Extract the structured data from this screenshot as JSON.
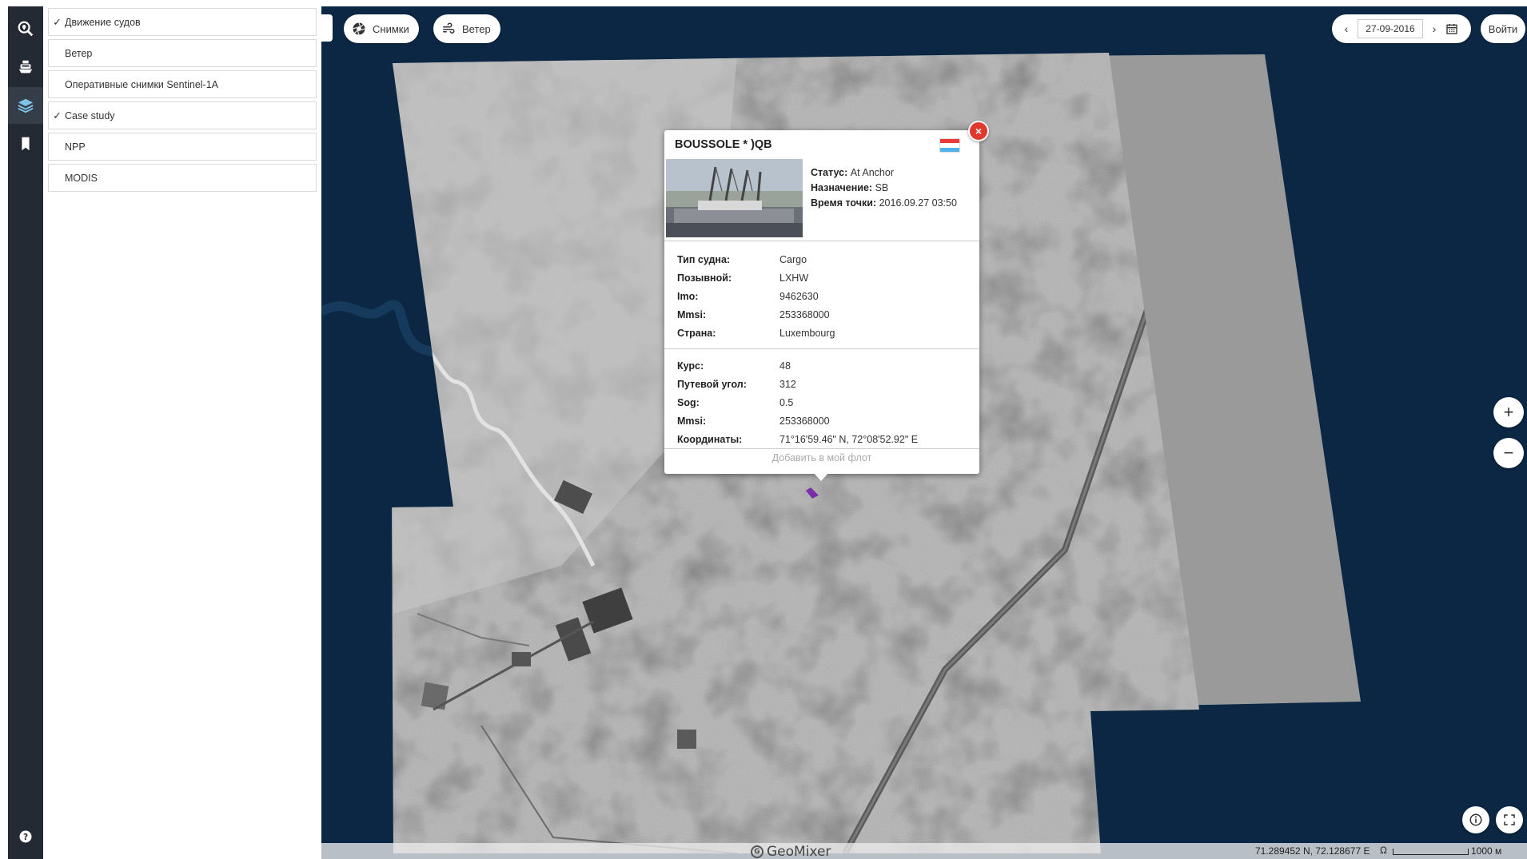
{
  "rail": {
    "items": [
      {
        "icon": "search-location-icon"
      },
      {
        "icon": "ship-icon"
      },
      {
        "icon": "layers-icon",
        "active": true
      },
      {
        "icon": "bookmark-icon"
      }
    ],
    "help_icon": "help-icon"
  },
  "layers": {
    "items": [
      {
        "label": "Движение судов",
        "check": "✓"
      },
      {
        "label": "Ветер",
        "check": ""
      },
      {
        "label": "Оперативные снимки Sentinel-1A",
        "check": ""
      },
      {
        "label": "Case study",
        "check": "✓"
      },
      {
        "label": "NPP",
        "check": ""
      },
      {
        "label": "MODIS",
        "check": ""
      }
    ]
  },
  "toolbar": {
    "snapshots_label": "Снимки",
    "wind_label": "Ветер",
    "date": "27-09-2016",
    "prev_arrow": "‹",
    "next_arrow": "›",
    "login_label": "Войти"
  },
  "zoom": {
    "in_label": "+",
    "out_label": "−"
  },
  "popup": {
    "title": "BOUSSOLE * )QB",
    "close_label": "×",
    "flag_colors": [
      "#ea3a3a",
      "#ffffff",
      "#4fb3e8"
    ],
    "summary": [
      {
        "key": "Статус:",
        "value": "At Anchor"
      },
      {
        "key": "Назначение:",
        "value": "SB"
      },
      {
        "key": "Время точки:",
        "value": "2016.09.27 03:50"
      }
    ],
    "props1": [
      {
        "key": "Тип судна:",
        "value": "Cargo"
      },
      {
        "key": "Позывной:",
        "value": "LXHW"
      },
      {
        "key": "Imo:",
        "value": "9462630"
      },
      {
        "key": "Mmsi:",
        "value": "253368000"
      },
      {
        "key": "Страна:",
        "value": "Luxembourg"
      }
    ],
    "props2": [
      {
        "key": "Курс:",
        "value": "48"
      },
      {
        "key": "Путевой угол:",
        "value": "312"
      },
      {
        "key": "Sog:",
        "value": "0.5"
      },
      {
        "key": "Mmsi:",
        "value": "253368000"
      },
      {
        "key": "Координаты:",
        "value": "71°16'59.46\" N, 72°08'52.92\" E"
      }
    ],
    "add_fleet_label": "Добавить в мой флот"
  },
  "statusbar": {
    "logo_text": "GeoMixer",
    "coords": "71.289452 N, 72.128677 E",
    "scale_label": "1000 м"
  },
  "colors": {
    "sea": "#0b2744",
    "rail": "#232a33",
    "close": "#e0382e",
    "marker": "#7a2fa8"
  }
}
